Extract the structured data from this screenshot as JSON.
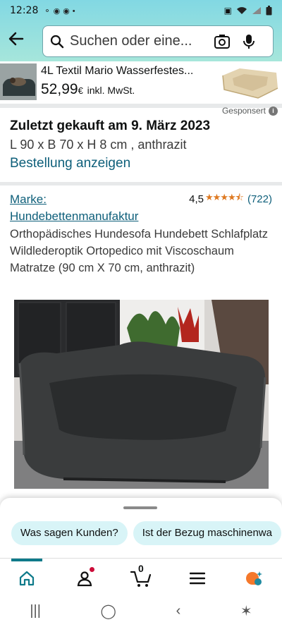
{
  "status_bar": {
    "time": "12:28",
    "notification_icons": [
      "messenger-icon",
      "whatsapp-icon",
      "whatsapp-icon",
      "dot-icon"
    ],
    "right_icons": [
      "battery-saver-icon",
      "wifi-icon",
      "signal-icon",
      "battery-icon"
    ]
  },
  "search": {
    "placeholder": "Suchen oder eine..."
  },
  "sponsored_ad": {
    "title": "4L Textil Mario Wasserfestes...",
    "price_whole": "52,99",
    "currency": "€",
    "vat": "inkl. MwSt.",
    "sponsored_label": "Gesponsert"
  },
  "last_purchase": {
    "heading": "Zuletzt gekauft am 9. März 2023",
    "dimensions": "L 90 x B 70 x H 8 cm , anthrazit",
    "view_order": "Bestellung anzeigen"
  },
  "product": {
    "brand_label": "Marke:",
    "brand_name": "Hundebettenmanufaktur",
    "rating": "4,5",
    "review_count": "(722)",
    "description": "Orthopädisches Hundesofa Hundebett Schlafplatz Wildlederoptik Ortopedico mit Viscoschaum Matratze (90 cm X 70 cm, anthrazit)"
  },
  "chips": [
    "Was sagen Kunden?",
    "Ist der Bezug maschinenwa"
  ],
  "bottom_nav": {
    "cart_count": "0",
    "items": [
      "home-icon",
      "account-icon",
      "cart-icon",
      "menu-icon",
      "rufus-icon"
    ]
  },
  "colors": {
    "header_top": "#82d8e3",
    "header_bottom": "#a6e6db",
    "link": "#0e5f7a",
    "star": "#de7921",
    "chip_bg": "#d8f4f7",
    "active_tab": "#0e7a8a"
  }
}
